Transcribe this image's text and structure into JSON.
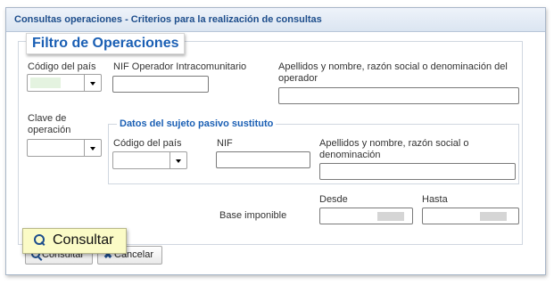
{
  "window": {
    "title": "Consultas operaciones - Criterios para la realización de consultas"
  },
  "filter": {
    "legend": "Filtro de Operaciones",
    "codigo_pais_label": "Código del país",
    "nif_operador_label": "NIF Operador Intracomunitario",
    "apellidos_operador_label": "Apellidos y nombre, razón social o denominación del operador",
    "clave_operacion_label": "Clave de operación",
    "codigo_pais_value": "",
    "nif_operador_value": "",
    "apellidos_operador_value": "",
    "clave_operacion_value": ""
  },
  "sustituto": {
    "legend": "Datos del sujeto pasivo sustituto",
    "codigo_pais_label": "Código del país",
    "nif_label": "NIF",
    "apellidos_label": "Apellidos y nombre, razón social o denominación",
    "codigo_pais_value": "",
    "nif_value": "",
    "apellidos_value": ""
  },
  "base": {
    "label": "Base imponible",
    "desde_label": "Desde",
    "hasta_label": "Hasta"
  },
  "buttons": {
    "consultar": "Consultar",
    "cancelar": "Cancelar"
  },
  "callout": {
    "label": "Consultar"
  },
  "colors": {
    "title": "#1e4e8c",
    "accent": "#1a5fb4",
    "callout_bg": "#fbfbc6"
  },
  "icons": {
    "consultar": "magnifier-icon",
    "cancelar": "close-icon"
  }
}
